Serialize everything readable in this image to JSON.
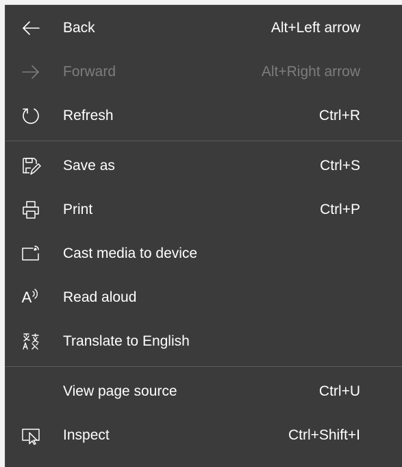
{
  "menu": {
    "items": [
      {
        "label": "Back",
        "shortcut": "Alt+Left arrow",
        "icon": "arrow-left-icon",
        "enabled": true
      },
      {
        "label": "Forward",
        "shortcut": "Alt+Right arrow",
        "icon": "arrow-right-icon",
        "enabled": false
      },
      {
        "label": "Refresh",
        "shortcut": "Ctrl+R",
        "icon": "refresh-icon",
        "enabled": true
      },
      {
        "label": "Save as",
        "shortcut": "Ctrl+S",
        "icon": "save-as-icon",
        "enabled": true
      },
      {
        "label": "Print",
        "shortcut": "Ctrl+P",
        "icon": "printer-icon",
        "enabled": true
      },
      {
        "label": "Cast media to device",
        "shortcut": "",
        "icon": "cast-icon",
        "enabled": true
      },
      {
        "label": "Read aloud",
        "shortcut": "",
        "icon": "read-aloud-icon",
        "enabled": true
      },
      {
        "label": "Translate to English",
        "shortcut": "",
        "icon": "translate-icon",
        "enabled": true
      },
      {
        "label": "View page source",
        "shortcut": "Ctrl+U",
        "icon": "",
        "enabled": true
      },
      {
        "label": "Inspect",
        "shortcut": "Ctrl+Shift+I",
        "icon": "inspect-icon",
        "enabled": true
      }
    ],
    "read_aloud_glyph": "A",
    "colors": {
      "background": "#3b3b3b",
      "text": "#ffffff",
      "disabled_text": "#7d7d7d",
      "divider": "#5a5a5a"
    }
  }
}
